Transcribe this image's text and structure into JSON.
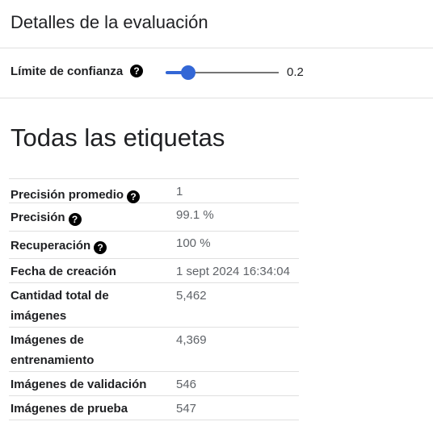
{
  "header": {
    "title": "Detalles de la evaluación"
  },
  "confidence": {
    "label": "Límite de confianza",
    "help_icon": "help-circle-icon",
    "value": 0.2,
    "value_label": "0.2",
    "accent": "#3367d6"
  },
  "section": {
    "title": "Todas las etiquetas"
  },
  "metrics": {
    "rows": [
      {
        "label": "Precisión promedio",
        "value": "1",
        "help": true
      },
      {
        "label": "Precisión",
        "value": "99.1 %",
        "help": true
      },
      {
        "label": "Recuperación",
        "value": "100 %",
        "help": true
      },
      {
        "label": "Fecha de creación",
        "value": "1 sept 2024 16:34:04",
        "help": false
      },
      {
        "label": "Cantidad total de imágenes",
        "value": "5,462",
        "help": false
      },
      {
        "label": "Imágenes de entrenamiento",
        "value": "4,369",
        "help": false
      },
      {
        "label": "Imágenes de validación",
        "value": "546",
        "help": false
      },
      {
        "label": "Imágenes de prueba",
        "value": "547",
        "help": false
      }
    ]
  }
}
